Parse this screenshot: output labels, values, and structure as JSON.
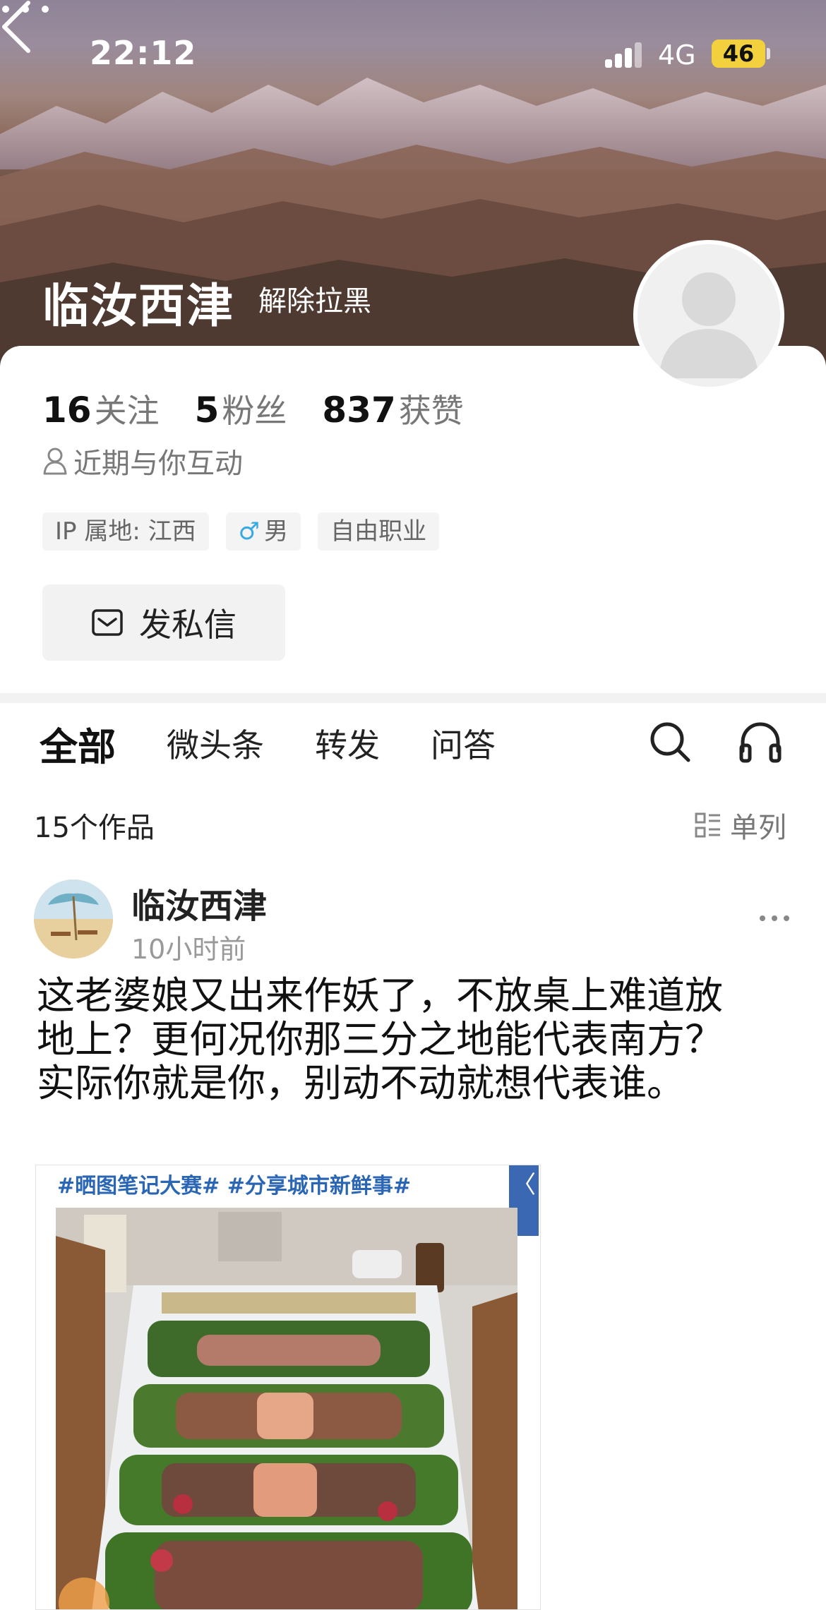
{
  "status_bar": {
    "time": "22:12",
    "network": "4G",
    "battery": "46"
  },
  "profile": {
    "name": "临汝西津",
    "unblock_label": "解除拉黑",
    "stats": [
      {
        "value": "16",
        "label": "关注"
      },
      {
        "value": "5",
        "label": "粉丝"
      },
      {
        "value": "837",
        "label": "获赞"
      }
    ],
    "interaction_note": "近期与你互动",
    "tags": {
      "ip": "IP 属地: 江西",
      "gender": "男",
      "occupation": "自由职业"
    },
    "message_button": "发私信"
  },
  "tabs": [
    "全部",
    "微头条",
    "转发",
    "问答"
  ],
  "works_count": "15个作品",
  "layout_toggle": "单列",
  "post": {
    "author": "临汝西津",
    "time": "10小时前",
    "text_lines": [
      "这老婆娘又出来作妖了，不放桌上难道放",
      "地上？更何况你那三分之地能代表南方？",
      "实际你就是你，别动不动就想代表谁。"
    ],
    "image_hashtags": "#晒图笔记大赛# #分享城市新鲜事#",
    "image_expand_glyph": "〈"
  },
  "colors": {
    "accent_blue": "#2b66b5",
    "battery": "#f3d03e",
    "gender_male": "#39a9e3"
  }
}
